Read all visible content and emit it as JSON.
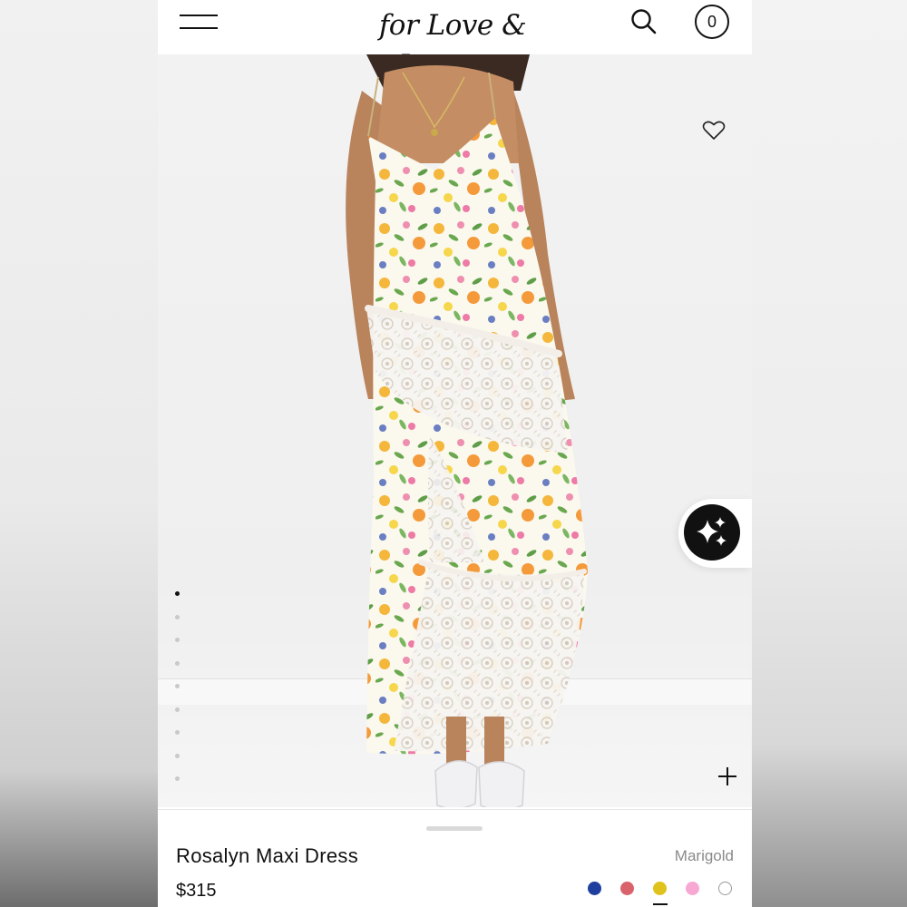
{
  "header": {
    "brand": "for Love & Lemons",
    "cart_count": "0"
  },
  "hero": {
    "image_count": 9,
    "active_image": 1
  },
  "product": {
    "name": "Rosalyn Maxi Dress",
    "price": "$315",
    "selected_color": "Marigold",
    "swatch_colors": [
      "#1f3f9e",
      "#d9626b",
      "#e0c21c",
      "#f7a8d2",
      "#ffffff"
    ],
    "selected_swatch_index": 2
  },
  "icons": [
    "menu-icon",
    "search-icon",
    "cart-icon",
    "heart-icon",
    "sparkles-icon",
    "plus-icon"
  ]
}
